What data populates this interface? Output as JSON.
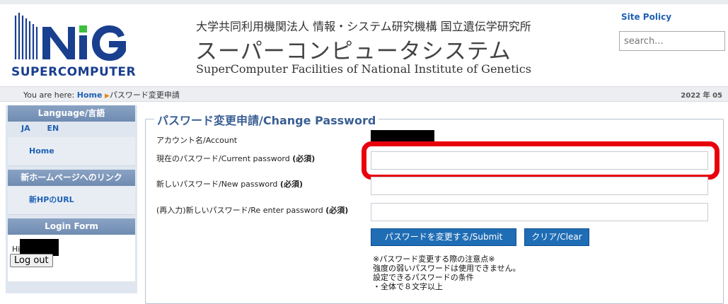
{
  "header": {
    "logo_text": "SUPERCOMPUTER",
    "org": "大学共同利用機関法人 情報・システム研究機構 国立遺伝学研究所",
    "title": "スーパーコンピュータシステム",
    "subtitle": "SuperComputer Facilities of National Institute of Genetics",
    "site_policy": "Site Policy",
    "search_placeholder": "search..."
  },
  "breadcrumb": {
    "prefix": "You are here:",
    "home": "Home",
    "current": "パスワード変更申請",
    "date": "2022 年 05"
  },
  "sidebar": {
    "language_heading": "Language/言語",
    "lang_ja": "JA",
    "lang_en": "EN",
    "home_link": "Home",
    "links_heading": "新ホームページへのリンク",
    "new_hp_link": "新HPのURL",
    "login_heading": "Login Form",
    "hi": "Hi",
    "logout": "Log out"
  },
  "form": {
    "legend": "パスワード変更申請/Change Password",
    "account_label": "アカウント名/Account",
    "current_label": "現在のパスワード/Current password",
    "new_label": "新しいパスワード/New password",
    "reenter_label": "(再入力)新しいパスワード/Re enter password",
    "required": "(必須)",
    "submit": "パスワードを変更する/Submit",
    "clear": "クリア/Clear",
    "note1": "※パスワード変更する際の注意点※",
    "note2": "強度の弱いパスワードは使用できません。",
    "note3": "設定できるパスワードの条件",
    "note4": "・全体で８文字以上"
  },
  "colors": {
    "brand_blue": "#1f61b3",
    "highlight_red": "#e8000d"
  }
}
